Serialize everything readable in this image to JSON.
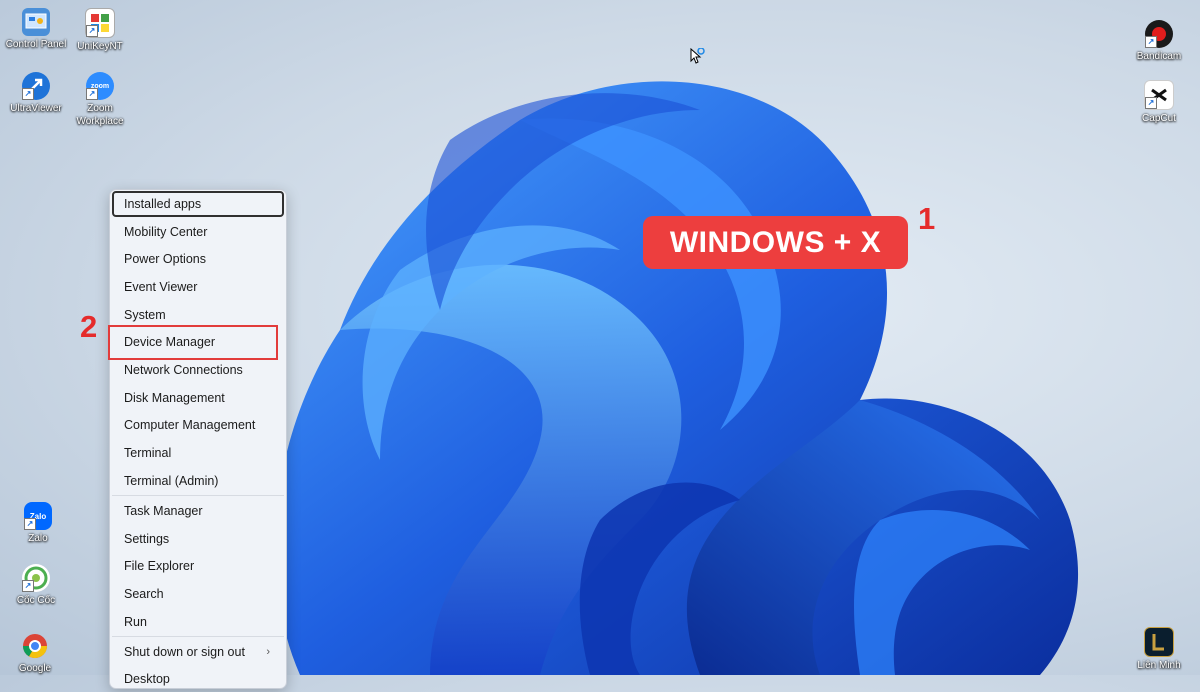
{
  "desktop_icons": {
    "control_panel": "Control Panel",
    "unikey": "UniKeyNT",
    "ultraviewer": "UltraViewer",
    "zoom": "Zoom Workplace",
    "bandicam": "Bandicam",
    "capcut": "CapCut",
    "zalo": "Zalo",
    "coccoc": "Cốc Cốc",
    "google": "Google",
    "lienminh": "Liên Minh"
  },
  "icon_glyphs": {
    "zoom": "zoom",
    "zalo": "Zalo"
  },
  "context_menu": {
    "group1": [
      "Installed apps",
      "Mobility Center",
      "Power Options",
      "Event Viewer",
      "System",
      "Device Manager",
      "Network Connections",
      "Disk Management",
      "Computer Management",
      "Terminal",
      "Terminal (Admin)"
    ],
    "group2": [
      "Task Manager",
      "Settings",
      "File Explorer",
      "Search",
      "Run"
    ],
    "group3": [
      "Shut down or sign out",
      "Desktop"
    ],
    "focused_item": "Installed apps",
    "highlighted_item": "Device Manager"
  },
  "annotations": {
    "step1_number": "1",
    "step2_number": "2",
    "shortcut_label": "WINDOWS + X"
  },
  "colors": {
    "highlight_red": "#e23b3b",
    "callout_bg": "#ed3e3e",
    "bloom_blue": "#1f5fe0"
  }
}
